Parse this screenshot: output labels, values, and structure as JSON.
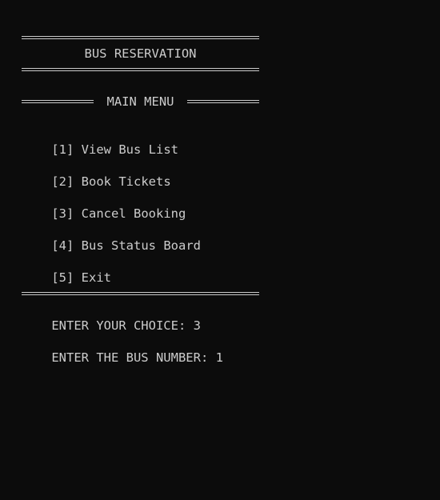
{
  "header": {
    "title": "BUS RESERVATION"
  },
  "menu": {
    "heading": "MAIN MENU",
    "items": [
      {
        "key": "[1]",
        "label": "View Bus List"
      },
      {
        "key": "[2]",
        "label": "Book Tickets"
      },
      {
        "key": "[3]",
        "label": "Cancel Booking"
      },
      {
        "key": "[4]",
        "label": "Bus Status Board"
      },
      {
        "key": "[5]",
        "label": "Exit"
      }
    ]
  },
  "prompts": {
    "choice_label": "ENTER YOUR CHOICE:",
    "choice_value": "3",
    "bus_label": "ENTER THE BUS NUMBER:",
    "bus_value": "1"
  },
  "colors": {
    "background": "#0c0c0c",
    "text": "#cccccc"
  }
}
